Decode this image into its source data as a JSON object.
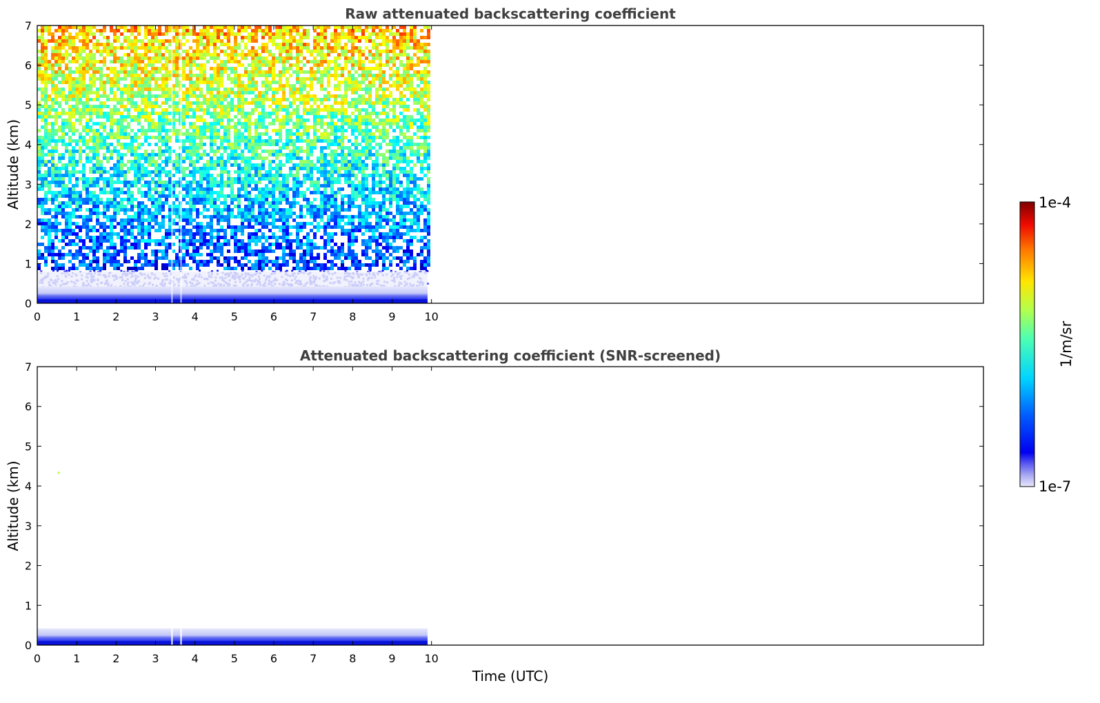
{
  "chart_data": [
    {
      "type": "heatmap",
      "title": "Raw attenuated backscattering coefficient",
      "xlabel": "",
      "ylabel": "Altitude (km)",
      "xlim": [
        0,
        24
      ],
      "ylim": [
        0,
        7
      ],
      "xticks": [
        0,
        1,
        2,
        3,
        4,
        5,
        6,
        7,
        8,
        9,
        10
      ],
      "yticks": [
        0,
        1,
        2,
        3,
        4,
        5,
        6,
        7
      ],
      "data_extent_time": [
        0,
        9.9
      ],
      "data_gaps_time": [
        3.4,
        3.63
      ],
      "field": "noisy lidar profile: dense near-surface layer below ~0.3 km, increasingly noisy signal with altitude up to 7 km"
    },
    {
      "type": "heatmap",
      "title": "Attenuated backscattering coefficient (SNR-screened)",
      "xlabel": "Time (UTC)",
      "ylabel": "Altitude (km)",
      "xlim": [
        0,
        24
      ],
      "ylim": [
        0,
        7
      ],
      "xticks": [
        0,
        1,
        2,
        3,
        4,
        5,
        6,
        7,
        8,
        9,
        10
      ],
      "yticks": [
        0,
        1,
        2,
        3,
        4,
        5,
        6,
        7
      ],
      "data_extent_time": [
        0,
        9.9
      ],
      "data_gaps_time": [
        3.4,
        3.63
      ],
      "field": "only near-surface layer below ~0.4 km retained after SNR screening"
    }
  ],
  "colorbar": {
    "label": "1/m/sr",
    "min_label": "1e-7",
    "max_label": "1e-4",
    "scale": "log",
    "range": [
      1e-07,
      0.0001
    ]
  }
}
